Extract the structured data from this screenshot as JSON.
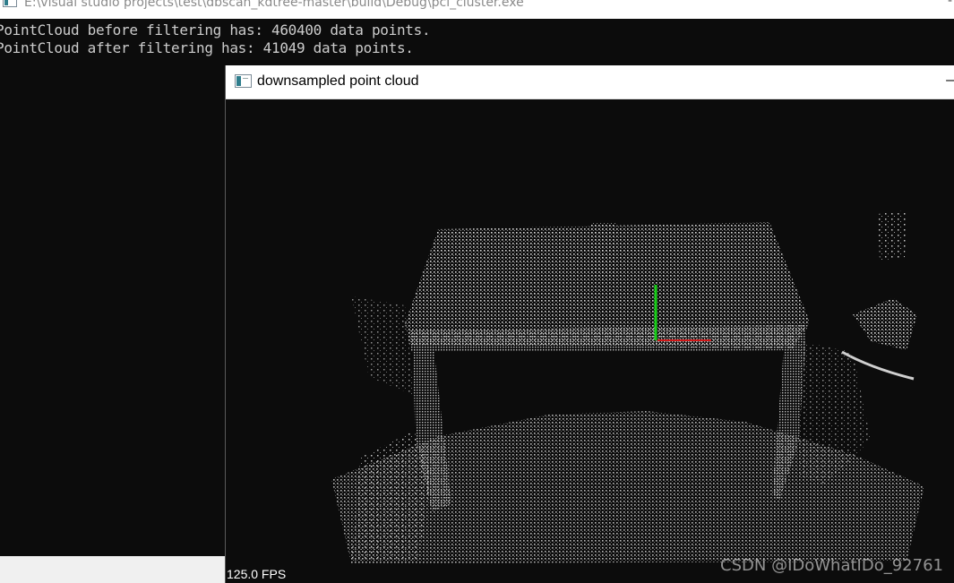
{
  "console": {
    "title": "E:\\visual studio projects\\test\\dbscan_kdtree-master\\build\\Debug\\pcl_cluster.exe",
    "lines": [
      "PointCloud before filtering has: 460400 data points.",
      "PointCloud after filtering has: 41049 data points."
    ],
    "minimize_glyph": "-"
  },
  "viewer": {
    "title": "downsampled point cloud",
    "minimize_glyph": "–",
    "fps": "125.0 FPS",
    "axis_colors": {
      "x": "#d01818",
      "y": "#18d018"
    }
  },
  "watermark": "CSDN @IDoWhatIDo_92761",
  "icons": [
    "console-app-icon",
    "viewer-app-icon"
  ]
}
